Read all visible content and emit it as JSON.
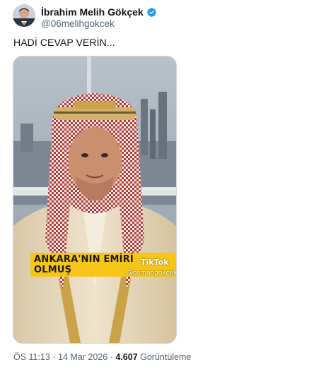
{
  "author": {
    "display_name": "İbrahim Melih Gökçek",
    "handle": "@06melihgokcek",
    "verified_icon": "verified-badge-icon",
    "accent_color": "#1d9bf0"
  },
  "tweet": {
    "text": "HADİ CEVAP VERİN..."
  },
  "video": {
    "caption": "ANKARA'NIN EMİRİ OLMUŞ",
    "watermark_logo": "TikTok",
    "watermark_handle": "@osmangokcek_"
  },
  "meta": {
    "time": "ÖS 11:13",
    "separator1": "·",
    "date": "14 Mar 2026",
    "separator2": "·",
    "views_count": "4.607",
    "views_label": "Görüntüleme"
  }
}
